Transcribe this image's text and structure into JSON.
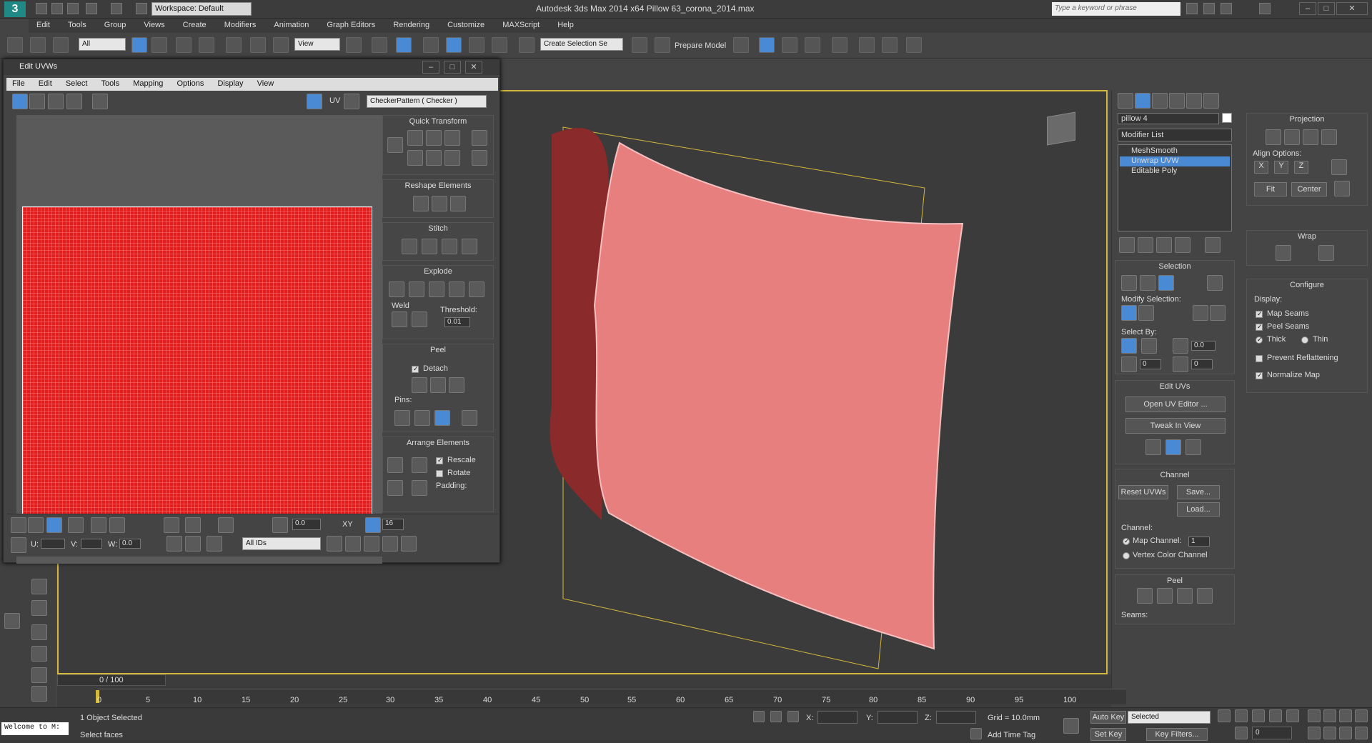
{
  "titlebar": {
    "workspace": "Workspace: Default",
    "app_title": "Autodesk 3ds Max  2014 x64      Pillow 63_corona_2014.max",
    "search_placeholder": "Type a keyword or phrase"
  },
  "menubar": [
    "Edit",
    "Tools",
    "Group",
    "Views",
    "Create",
    "Modifiers",
    "Animation",
    "Graph Editors",
    "Rendering",
    "Customize",
    "MAXScript",
    "Help"
  ],
  "toolbar": {
    "selection_filter": "All",
    "ref_coord": "View",
    "create_selection_set": "Create Selection Se",
    "prepare_model": "Prepare Model"
  },
  "uvw_editor": {
    "title": "Edit UVWs",
    "menu": [
      "File",
      "Edit",
      "Select",
      "Tools",
      "Mapping",
      "Options",
      "Display",
      "View"
    ],
    "uv_label": "UV",
    "checker_dropdown": "CheckerPattern  ( Checker )",
    "rollouts": {
      "quick_transform": "Quick Transform",
      "reshape": "Reshape Elements",
      "stitch": "Stitch",
      "explode": "Explode",
      "weld": "Weld",
      "threshold_label": "Threshold:",
      "threshold_value": "0.01",
      "peel": "Peel",
      "detach": "Detach",
      "pins": "Pins:",
      "arrange": "Arrange Elements",
      "rescale": "Rescale",
      "rotate": "Rotate",
      "padding": "Padding:"
    },
    "bottom": {
      "soft_value": "0.0",
      "xy": "XY",
      "grid_value": "16",
      "u_label": "U:",
      "v_label": "V:",
      "w_label": "W:",
      "w_value": "0.0",
      "ids_dropdown": "All IDs"
    }
  },
  "command_panel": {
    "object_name": "pillow 4",
    "modifier_list": "Modifier List",
    "stack": [
      "MeshSmooth",
      "Unwrap UVW",
      "Editable Poly"
    ],
    "selection_title": "Selection",
    "modify_selection": "Modify Selection:",
    "select_by": "Select By:",
    "angle_value": "0.0",
    "sel_a": "0",
    "sel_b": "0",
    "edit_uvs_title": "Edit UVs",
    "open_uv_editor": "Open UV Editor ...",
    "tweak_in_view": "Tweak In View",
    "channel_title": "Channel",
    "reset_uvws": "Reset UVWs",
    "save": "Save...",
    "load": "Load...",
    "channel_label": "Channel:",
    "map_channel": "Map Channel:",
    "map_channel_value": "1",
    "vertex_color_channel": "Vertex Color Channel",
    "peel_title": "Peel",
    "seams": "Seams:",
    "projection_title": "Projection",
    "align_options": "Align Options:",
    "x": "X",
    "y": "Y",
    "z": "Z",
    "fit": "Fit",
    "center": "Center",
    "wrap_title": "Wrap",
    "configure_title": "Configure",
    "display": "Display:",
    "map_seams": "Map Seams",
    "peel_seams": "Peel Seams",
    "thick": "Thick",
    "thin": "Thin",
    "prevent_reflattening": "Prevent Reflattening",
    "normalize_map": "Normalize Map"
  },
  "timeline": {
    "frame": "0 / 100",
    "ticks": [
      "0",
      "5",
      "10",
      "15",
      "20",
      "25",
      "30",
      "35",
      "40",
      "45",
      "50",
      "55",
      "60",
      "65",
      "70",
      "75",
      "80",
      "85",
      "90",
      "95",
      "100"
    ]
  },
  "status": {
    "welcome": "Welcome to M:",
    "objects_selected": "1 Object Selected",
    "prompt": "Select faces",
    "x_label": "X:",
    "y_label": "Y:",
    "z_label": "Z:",
    "grid": "Grid = 10.0mm",
    "add_time_tag": "Add Time Tag",
    "auto_key": "Auto Key",
    "set_key": "Set Key",
    "selected_dropdown": "Selected",
    "key_filters": "Key Filters...",
    "current_frame": "0"
  },
  "colors": {
    "viewport_border": "#d4b93a",
    "checker_red": "#e01e1e",
    "highlight_blue": "#4a8ad4",
    "pillow_front": "#e87f7f",
    "pillow_back": "#8a2a2a"
  }
}
